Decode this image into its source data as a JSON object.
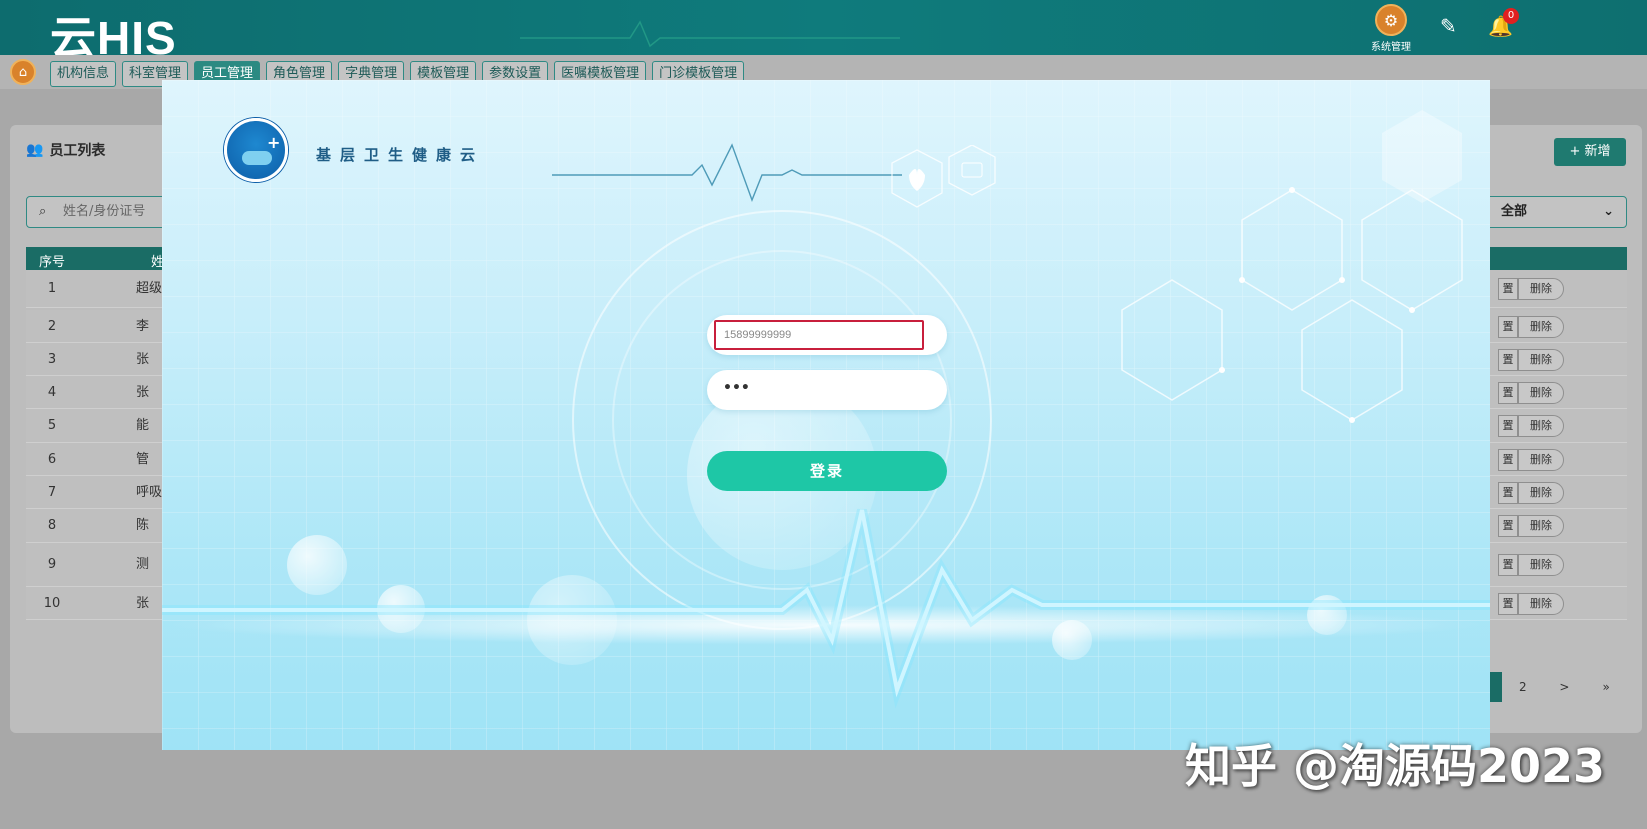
{
  "app": {
    "brand": "云HIS"
  },
  "header": {
    "system_label": "系统管理",
    "notification_count": "0"
  },
  "nav_tabs": [
    "机构信息",
    "科室管理",
    "员工管理",
    "角色管理",
    "字典管理",
    "模板管理",
    "参数设置",
    "医嘱模板管理",
    "门诊模板管理"
  ],
  "active_tab_index": 2,
  "panel": {
    "title": "员工列表",
    "add_label": "新增",
    "search_placeholder": "姓名/身份证号",
    "filter_value": "全部"
  },
  "table": {
    "headers": [
      "序号",
      "姓"
    ],
    "rows": [
      {
        "no": "1",
        "name": "超级"
      },
      {
        "no": "2",
        "name": "李"
      },
      {
        "no": "3",
        "name": "张"
      },
      {
        "no": "4",
        "name": "张"
      },
      {
        "no": "5",
        "name": "能"
      },
      {
        "no": "6",
        "name": "管"
      },
      {
        "no": "7",
        "name": "呼吸"
      },
      {
        "no": "8",
        "name": "陈"
      },
      {
        "no": "9",
        "name": "测"
      },
      {
        "no": "10",
        "name": "张"
      }
    ],
    "op_edit": "置",
    "op_delete": "删除"
  },
  "pager": {
    "page2": "2",
    "next": ">",
    "last": "»"
  },
  "login": {
    "slogan": "基层卫生健康云",
    "username_value": "15899999999",
    "password_mask": "•••",
    "submit_label": "登录"
  },
  "watermark": "知乎 @淘源码2023",
  "colors": {
    "brand_teal": "#0f7b7c",
    "login_button": "#1ec7a6",
    "focus_border": "#c81f3c"
  }
}
